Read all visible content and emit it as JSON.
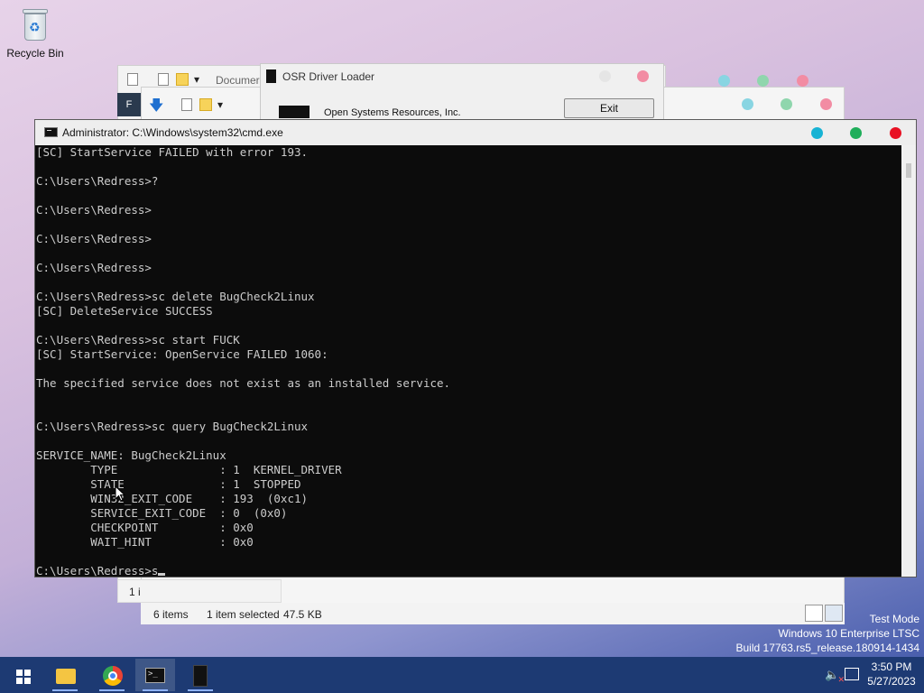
{
  "desktop": {
    "recycle_bin_label": "Recycle Bin"
  },
  "explorer": {
    "partial_title": "Documer",
    "items_count": "6 items",
    "selected_info": "1 item selected",
    "selected_size": "47.5 KB",
    "items_partial": "1 i",
    "tab_letter": "F"
  },
  "osr": {
    "title": "OSR Driver Loader",
    "org": "Open Systems Resources, Inc.",
    "exit_label": "Exit"
  },
  "cmd": {
    "title": "Administrator: C:\\Windows\\system32\\cmd.exe",
    "lines": [
      "[SC] StartService FAILED with error 193.",
      "",
      "C:\\Users\\Redress>?",
      "",
      "C:\\Users\\Redress>",
      "",
      "C:\\Users\\Redress>",
      "",
      "C:\\Users\\Redress>",
      "",
      "C:\\Users\\Redress>sc delete BugCheck2Linux",
      "[SC] DeleteService SUCCESS",
      "",
      "C:\\Users\\Redress>sc start FUCK",
      "[SC] StartService: OpenService FAILED 1060:",
      "",
      "The specified service does not exist as an installed service.",
      "",
      "",
      "C:\\Users\\Redress>sc query BugCheck2Linux",
      "",
      "SERVICE_NAME: BugCheck2Linux",
      "        TYPE               : 1  KERNEL_DRIVER",
      "        STATE              : 1  STOPPED",
      "        WIN32_EXIT_CODE    : 193  (0xc1)",
      "        SERVICE_EXIT_CODE  : 0  (0x0)",
      "        CHECKPOINT         : 0x0",
      "        WAIT_HINT          : 0x0",
      ""
    ],
    "prompt_line": "C:\\Users\\Redress>s"
  },
  "watermark": {
    "line1": "Test Mode",
    "line2": "Windows 10 Enterprise LTSC",
    "line3": "Build 17763.rs5_release.180914-1434"
  },
  "taskbar": {
    "time": "3:50 PM",
    "date": "5/27/2023",
    "apps": [
      "start-icon",
      "file-explorer-icon",
      "chrome-icon",
      "cmd-icon",
      "osr-loader-icon"
    ]
  },
  "colors": {
    "close": "#e81123",
    "min": "#17b3d4",
    "max": "#1fae5a",
    "taskbar": "#1d3a73",
    "console_bg": "#0c0c0c",
    "console_fg": "#cccccc"
  }
}
